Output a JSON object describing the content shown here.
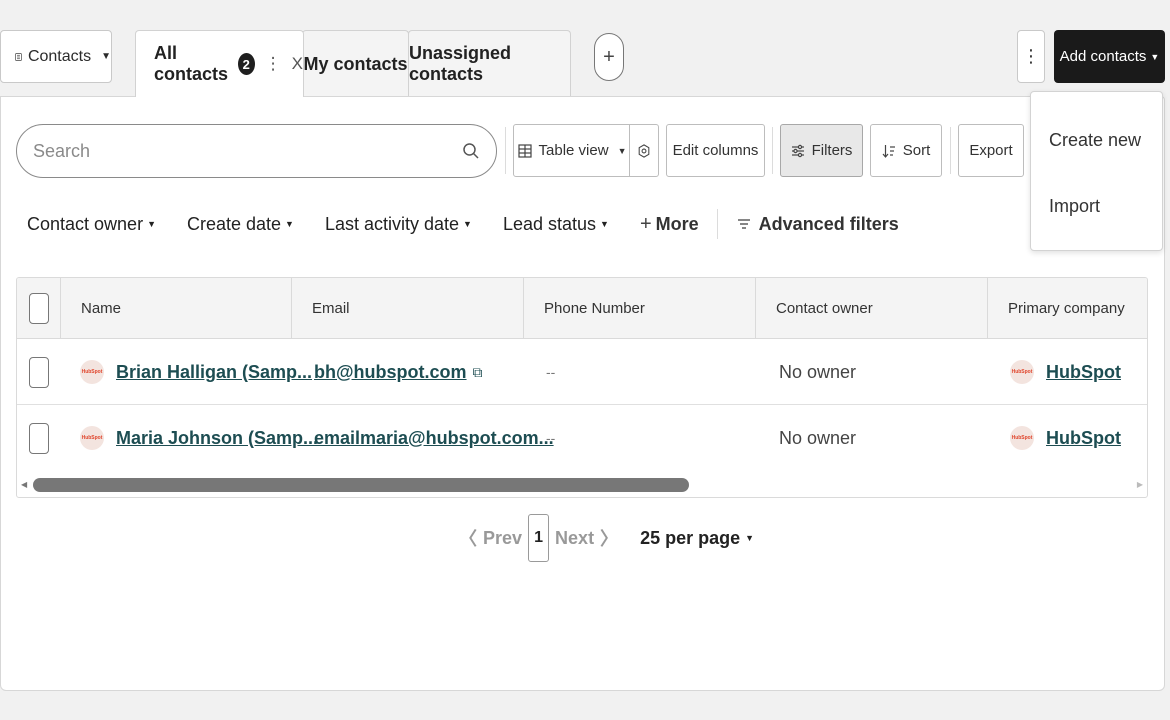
{
  "object_selector": {
    "label": "Contacts"
  },
  "tabs": [
    {
      "label": "All contacts",
      "badge": "2"
    },
    {
      "label": "My contacts"
    },
    {
      "label": "Unassigned contacts"
    }
  ],
  "header": {
    "tab_menu_glyph": "⋮",
    "tab_close_glyph": "X",
    "add_tab_glyph": "+",
    "more_actions_glyph": "⋮",
    "add_contacts_label": "Add contacts"
  },
  "dropdown": {
    "items": [
      "Create new",
      "Import"
    ]
  },
  "toolbar": {
    "search_placeholder": "Search",
    "table_view_label": "Table view",
    "edit_columns_label": "Edit columns",
    "filters_label": "Filters",
    "sort_label": "Sort",
    "export_label": "Export"
  },
  "filters": {
    "items": [
      "Contact owner",
      "Create date",
      "Last activity date",
      "Lead status"
    ],
    "more_label": "More",
    "advanced_label": "Advanced filters"
  },
  "table": {
    "columns": [
      "Name",
      "Email",
      "Phone Number",
      "Contact owner",
      "Primary company"
    ],
    "rows": [
      {
        "name": "Brian Halligan (Samp...",
        "email": "bh@hubspot.com",
        "phone": "--",
        "owner": "No owner",
        "company": "HubSpot"
      },
      {
        "name": "Maria Johnson (Samp...",
        "email": "emailmaria@hubspot.com...",
        "phone": "--",
        "owner": "No owner",
        "company": "HubSpot"
      }
    ],
    "logo_text": "HubSpot"
  },
  "pagination": {
    "prev_label": "Prev",
    "current_page": "1",
    "next_label": "Next",
    "per_page_label": "25 per page"
  },
  "colors": {
    "link": "#1d4d52",
    "primary_button": "#1a1a1a",
    "logo": "#e0452c"
  }
}
